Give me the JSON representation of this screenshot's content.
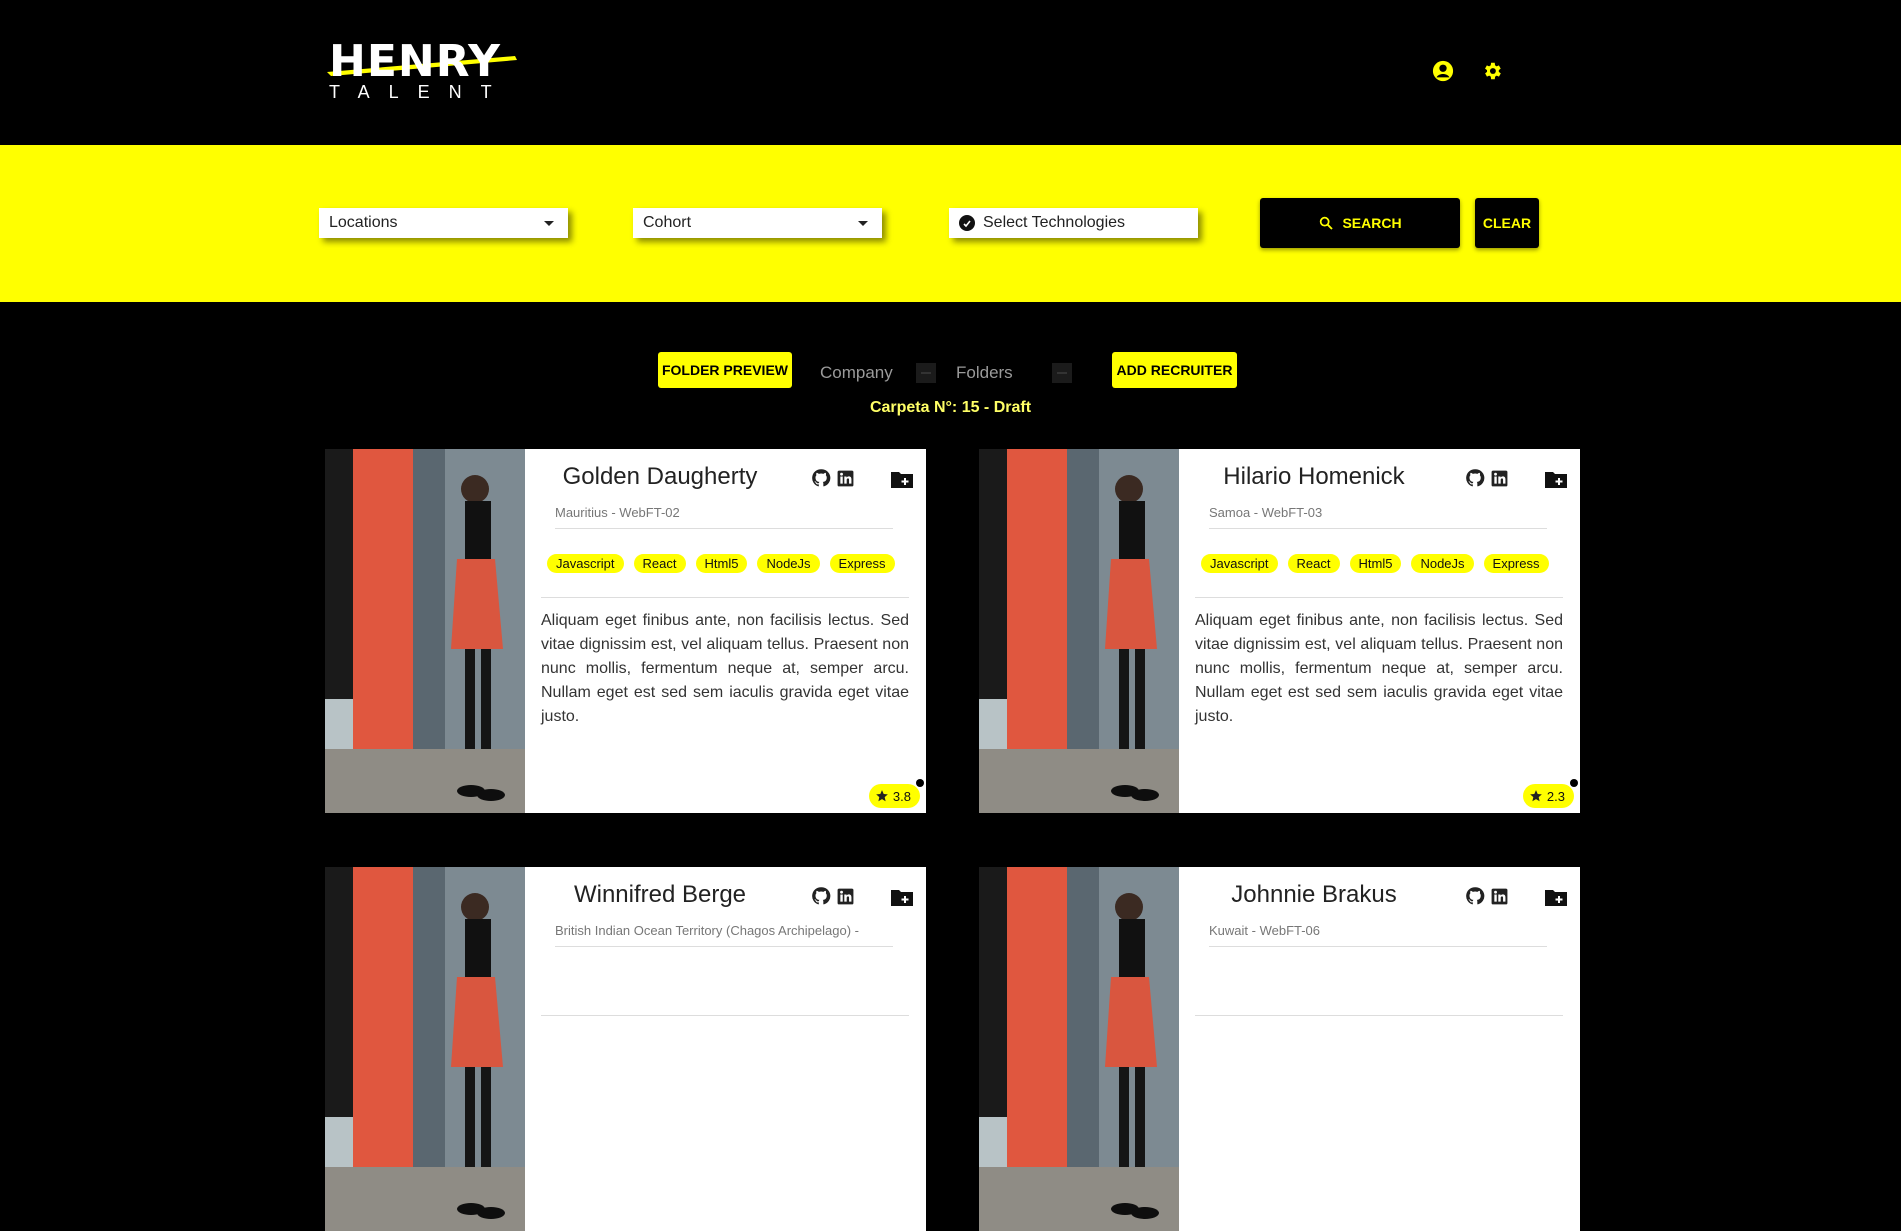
{
  "brand": {
    "logo_top": "HENRY",
    "logo_bottom": "TALENT",
    "accent": "#ffff00"
  },
  "header": {
    "icons": [
      "user-circle-icon",
      "gear-icon"
    ]
  },
  "filters": {
    "locations": "Locations",
    "cohort": "Cohort",
    "technologies": "Select Technologies",
    "search_label": "SEARCH",
    "clear_label": "CLEAR"
  },
  "toolbar": {
    "folder_preview": "FOLDER PREVIEW",
    "company": "Company",
    "folders": "Folders",
    "add_recruiter": "ADD RECRUITER",
    "folder_status": "Carpeta N°: 15 - Draft"
  },
  "cards": [
    {
      "name": "Golden Daugherty",
      "subtitle": "Mauritius - WebFT-02",
      "tags": [
        "Javascript",
        "React",
        "Html5",
        "NodeJs",
        "Express"
      ],
      "description": "Aliquam eget finibus ante, non facilisis lectus. Sed vitae dignissim est, vel aliquam tellus. Praesent non nunc mollis, fermentum neque at, semper arcu. Nullam eget est sed sem iaculis gravida eget vitae justo.",
      "rating": "3.8"
    },
    {
      "name": "Hilario Homenick",
      "subtitle": "Samoa - WebFT-03",
      "tags": [
        "Javascript",
        "React",
        "Html5",
        "NodeJs",
        "Express"
      ],
      "description": "Aliquam eget finibus ante, non facilisis lectus. Sed vitae dignissim est, vel aliquam tellus. Praesent non nunc mollis, fermentum neque at, semper arcu. Nullam eget est sed sem iaculis gravida eget vitae justo.",
      "rating": "2.3"
    },
    {
      "name": "Winnifred Berge",
      "subtitle": "British Indian Ocean Territory (Chagos Archipelago) - "
    },
    {
      "name": "Johnnie Brakus",
      "subtitle": "Kuwait - WebFT-06"
    }
  ]
}
